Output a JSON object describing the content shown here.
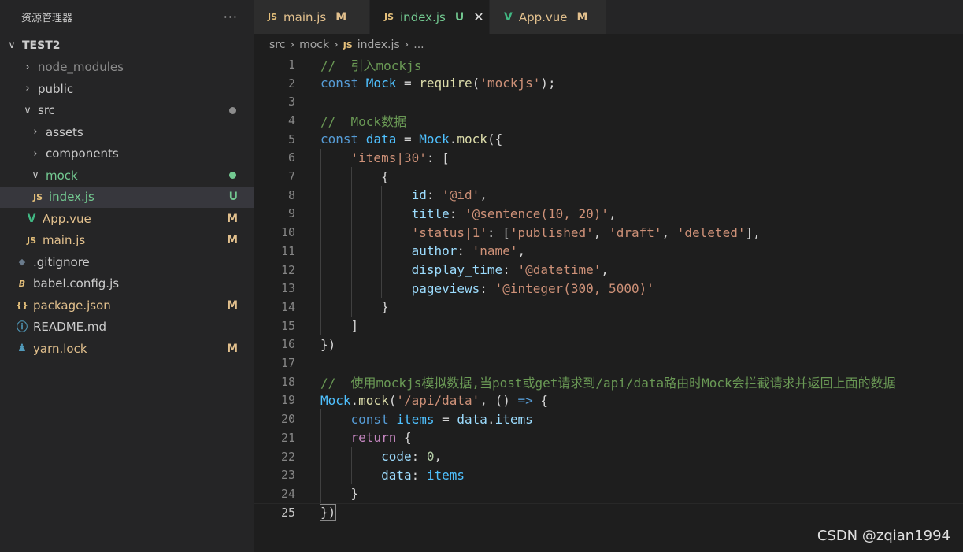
{
  "explorer": {
    "title": "资源管理器",
    "more": "···",
    "items": [
      {
        "label": "TEST2",
        "chevron": "∨",
        "indent": 8,
        "type": "root"
      },
      {
        "label": "node_modules",
        "chevron": "›",
        "indent": 28,
        "type": "folder-dim"
      },
      {
        "label": "public",
        "chevron": "›",
        "indent": 28,
        "type": "folder"
      },
      {
        "label": "src",
        "chevron": "∨",
        "indent": 28,
        "type": "folder-src",
        "dot": "#8c8c8c"
      },
      {
        "label": "assets",
        "chevron": "›",
        "indent": 38,
        "type": "folder"
      },
      {
        "label": "components",
        "chevron": "›",
        "indent": 38,
        "type": "folder"
      },
      {
        "label": "mock",
        "chevron": "∨",
        "indent": 38,
        "type": "folder-untracked",
        "dot": "#73c991"
      },
      {
        "label": "index.js",
        "icon": "JS",
        "indent": 40,
        "type": "file-untracked",
        "status": "U",
        "selected": true
      },
      {
        "label": "App.vue",
        "icon": "V",
        "indent": 32,
        "type": "file-vue",
        "status": "M"
      },
      {
        "label": "main.js",
        "icon": "JS",
        "indent": 32,
        "type": "file-mod",
        "status": "M"
      },
      {
        "label": ".gitignore",
        "icon": "◆",
        "indent": 20,
        "type": "file-plain"
      },
      {
        "label": "babel.config.js",
        "icon": "B",
        "indent": 20,
        "type": "file-plain"
      },
      {
        "label": "package.json",
        "icon": "{}",
        "indent": 20,
        "type": "file-mod",
        "status": "M"
      },
      {
        "label": "README.md",
        "icon": "ⓘ",
        "indent": 20,
        "type": "file-plain"
      },
      {
        "label": "yarn.lock",
        "icon": "♟",
        "indent": 20,
        "type": "file-mod",
        "status": "M"
      }
    ]
  },
  "tabs": [
    {
      "icon": "JS",
      "label": "main.js",
      "status": "M",
      "active": false
    },
    {
      "icon": "JS",
      "label": "index.js",
      "status": "U",
      "active": true,
      "close": "✕"
    },
    {
      "icon": "V",
      "label": "App.vue",
      "status": "M",
      "active": false
    }
  ],
  "breadcrumb": {
    "parts": [
      "src",
      "mock"
    ],
    "file_icon": "JS",
    "file": "index.js",
    "tail": "..."
  },
  "editor": {
    "current_line": 25,
    "lines": [
      [
        [
          "c",
          "//  引入mockjs"
        ]
      ],
      [
        [
          "k",
          "const "
        ],
        [
          "v",
          "Mock"
        ],
        [
          "p",
          " = "
        ],
        [
          "f",
          "require"
        ],
        [
          "p",
          "("
        ],
        [
          "s",
          "'mockjs'"
        ],
        [
          "p",
          ");"
        ]
      ],
      [],
      [
        [
          "c",
          "//  Mock数据"
        ]
      ],
      [
        [
          "k",
          "const "
        ],
        [
          "v",
          "data"
        ],
        [
          "p",
          " = "
        ],
        [
          "v",
          "Mock"
        ],
        [
          "p",
          "."
        ],
        [
          "f",
          "mock"
        ],
        [
          "p",
          "({"
        ]
      ],
      [
        [
          "p",
          "    "
        ],
        [
          "s",
          "'items|30'"
        ],
        [
          "p",
          ": ["
        ]
      ],
      [
        [
          "p",
          "        {"
        ]
      ],
      [
        [
          "p",
          "            "
        ],
        [
          "pr",
          "id"
        ],
        [
          "p",
          ": "
        ],
        [
          "s",
          "'@id'"
        ],
        [
          "p",
          ","
        ]
      ],
      [
        [
          "p",
          "            "
        ],
        [
          "pr",
          "title"
        ],
        [
          "p",
          ": "
        ],
        [
          "s",
          "'@sentence(10, 20)'"
        ],
        [
          "p",
          ","
        ]
      ],
      [
        [
          "p",
          "            "
        ],
        [
          "s",
          "'status|1'"
        ],
        [
          "p",
          ": ["
        ],
        [
          "s",
          "'published'"
        ],
        [
          "p",
          ", "
        ],
        [
          "s",
          "'draft'"
        ],
        [
          "p",
          ", "
        ],
        [
          "s",
          "'deleted'"
        ],
        [
          "p",
          "],"
        ]
      ],
      [
        [
          "p",
          "            "
        ],
        [
          "pr",
          "author"
        ],
        [
          "p",
          ": "
        ],
        [
          "s",
          "'name'"
        ],
        [
          "p",
          ","
        ]
      ],
      [
        [
          "p",
          "            "
        ],
        [
          "pr",
          "display_time"
        ],
        [
          "p",
          ": "
        ],
        [
          "s",
          "'@datetime'"
        ],
        [
          "p",
          ","
        ]
      ],
      [
        [
          "p",
          "            "
        ],
        [
          "pr",
          "pageviews"
        ],
        [
          "p",
          ": "
        ],
        [
          "s",
          "'@integer(300, 5000)'"
        ]
      ],
      [
        [
          "p",
          "        }"
        ]
      ],
      [
        [
          "p",
          "    ]"
        ]
      ],
      [
        [
          "p",
          "})"
        ]
      ],
      [],
      [
        [
          "c",
          "//  使用mockjs模拟数据,当post或get请求到/api/data路由时Mock会拦截请求并返回上面的数据"
        ]
      ],
      [
        [
          "v",
          "Mock"
        ],
        [
          "p",
          "."
        ],
        [
          "f",
          "mock"
        ],
        [
          "p",
          "("
        ],
        [
          "s",
          "'/api/data'"
        ],
        [
          "p",
          ", () "
        ],
        [
          "k",
          "=>"
        ],
        [
          "p",
          " {"
        ]
      ],
      [
        [
          "p",
          "    "
        ],
        [
          "k",
          "const "
        ],
        [
          "v",
          "items"
        ],
        [
          "p",
          " = "
        ],
        [
          "pr",
          "data"
        ],
        [
          "p",
          "."
        ],
        [
          "pr",
          "items"
        ]
      ],
      [
        [
          "p",
          "    "
        ],
        [
          "kw",
          "return"
        ],
        [
          "p",
          " {"
        ]
      ],
      [
        [
          "p",
          "        "
        ],
        [
          "pr",
          "code"
        ],
        [
          "p",
          ": "
        ],
        [
          "n",
          "0"
        ],
        [
          "p",
          ","
        ]
      ],
      [
        [
          "p",
          "        "
        ],
        [
          "pr",
          "data"
        ],
        [
          "p",
          ": "
        ],
        [
          "v",
          "items"
        ]
      ],
      [
        [
          "p",
          "    }"
        ]
      ],
      [
        [
          "p",
          "})"
        ]
      ]
    ]
  },
  "watermark": "CSDN @zqian1994",
  "colors": {
    "c": "#6a9955",
    "k": "#569cd6",
    "v": "#4fc1ff",
    "f": "#dcdcaa",
    "s": "#ce9178",
    "p": "#d4d4d4",
    "pr": "#9cdcfe",
    "n": "#b5cea8",
    "kw": "#c586c0"
  }
}
